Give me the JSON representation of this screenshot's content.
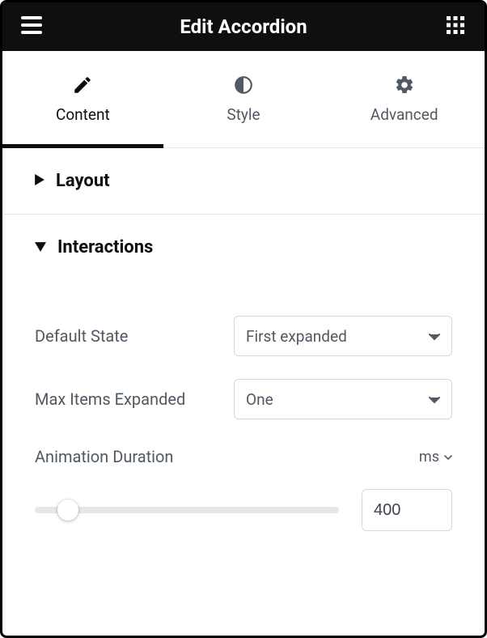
{
  "header": {
    "title": "Edit Accordion"
  },
  "tabs": [
    {
      "label": "Content",
      "active": true
    },
    {
      "label": "Style",
      "active": false
    },
    {
      "label": "Advanced",
      "active": false
    }
  ],
  "sections": {
    "layout": {
      "title": "Layout",
      "expanded": false
    },
    "interactions": {
      "title": "Interactions",
      "expanded": true,
      "defaultState": {
        "label": "Default State",
        "value": "First expanded"
      },
      "maxItemsExpanded": {
        "label": "Max Items Expanded",
        "value": "One"
      },
      "animationDuration": {
        "label": "Animation Duration",
        "unit": "ms",
        "value": "400",
        "sliderPercent": 11
      }
    }
  }
}
